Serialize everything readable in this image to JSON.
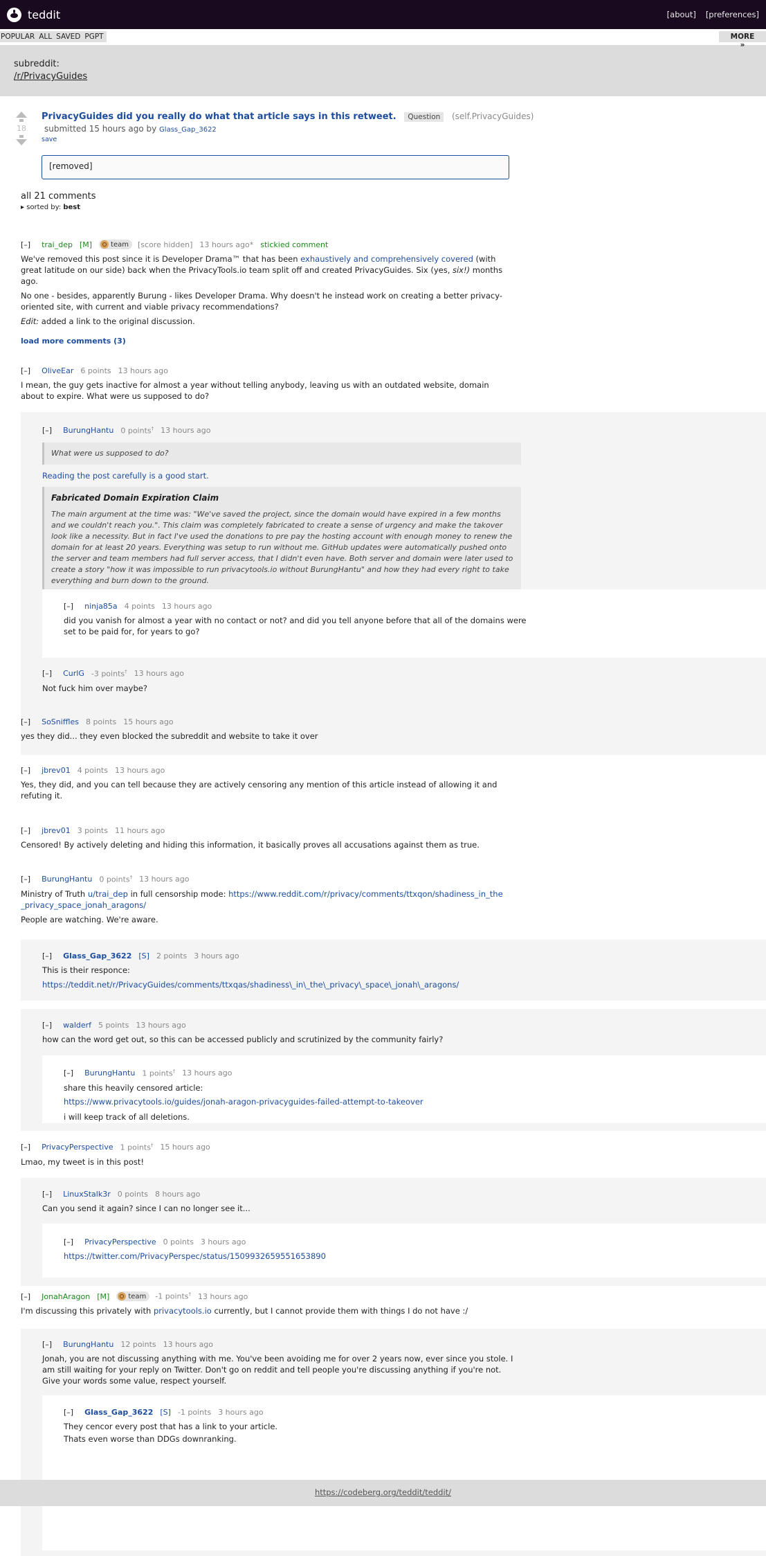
{
  "app": {
    "title": "teddit"
  },
  "topnav": {
    "about": "[about]",
    "preferences": "[preferences]"
  },
  "subnav": {
    "items": [
      "POPULAR",
      "ALL",
      "SAVED",
      "PGPT"
    ],
    "more": "MORE »"
  },
  "subreddit": {
    "label": "subreddit:",
    "name": "/r/PrivacyGuides"
  },
  "post": {
    "score": "18",
    "title": "PrivacyGuides did you really do what that article says in this retweet.",
    "flair": "Question",
    "domain": "(self.PrivacyGuides)",
    "submitted": "submitted 15 hours ago by",
    "author": "Glass_Gap_3622",
    "save": "save",
    "selftext": "[removed]"
  },
  "comments_header": {
    "count": "all 21 comments",
    "sorted_prefix": "▸ sorted by:",
    "sorted_value": "best"
  },
  "load_more": "load more comments (3)",
  "toggle": "[–]",
  "comments": {
    "c1": {
      "author": "trai_dep",
      "mod": "[M]",
      "badge": "team",
      "score": "[score hidden]",
      "time": "13 hours ago*",
      "stickied": "stickied comment",
      "p1a": "We've removed this post since it is Developer Drama™ that has been ",
      "p1link": "exhaustively and comprehensively covered",
      "p1b": " (with great latitude on our side) back when the PrivacyTools.io team split off and created PrivacyGuides. Six (yes, ",
      "p1em": "six!)",
      "p1c": " months ago.",
      "p2": "No one - besides, apparently Burung - likes Developer Drama. Why doesn't he instead work on creating a better privacy-oriented site, with current and viable privacy recommendations?",
      "p3em": "Edit:",
      "p3": " added a link to the original discussion."
    },
    "c2": {
      "author": "OliveEar",
      "points": "6 points",
      "time": "13 hours ago",
      "text": "I mean, the guy gets inactive for almost a year without telling anybody, leaving us with an outdated website, domain about to expire. What were us supposed to do?"
    },
    "c3": {
      "author": "BurungHantu",
      "points": "0 points",
      "dagger": "†",
      "time": "13 hours ago",
      "quote1": "What were us supposed to do?",
      "link": "Reading the post carefully is a good start.",
      "quote_title": "Fabricated Domain Expiration Claim",
      "quote2": "The main argument at the time was: \"We've saved the project, since the domain would have expired in a few months and we couldn't reach you.\". This claim was completely fabricated to create a sense of urgency and make the takover look like a necessity. But in fact I've used the donations to pre pay the hosting account with enough money to renew the domain for at least 20 years. Everything was setup to run without me. GitHub updates were automatically pushed onto the server and team members had full server access, that I didn't even have. Both server and domain were later used to create a story \"how it was impossible to run privacytools.io without BurungHantu\" and how they had every right to take everything and burn down to the ground."
    },
    "c4": {
      "author": "ninja85a",
      "points": "4 points",
      "time": "13 hours ago",
      "text": "did you vanish for almost a year with no contact or not? and did you tell anyone before that all of the domains were set to be paid for, for years to go?"
    },
    "c5": {
      "author": "CurlG",
      "points": "-3 points",
      "dagger": "†",
      "time": "13 hours ago",
      "text": "Not fuck him over maybe?"
    },
    "c6": {
      "author": "SoSniffles",
      "points": "8 points",
      "time": "15 hours ago",
      "text": "yes they did... they even blocked the subreddit and website to take it over"
    },
    "c7": {
      "author": "jbrev01",
      "points": "4 points",
      "time": "13 hours ago",
      "text": "Yes, they did, and you can tell because they are actively censoring any mention of this article instead of allowing it and refuting it."
    },
    "c8": {
      "author": "jbrev01",
      "points": "3 points",
      "time": "11 hours ago",
      "text": "Censored! By actively deleting and hiding this information, it basically proves all accusations against them as true."
    },
    "c9": {
      "author": "BurungHantu",
      "points": "0 points",
      "dagger": "†",
      "time": "13 hours ago",
      "t1": "Ministry of Truth ",
      "l1": "u/trai_dep",
      "t2": " in full censorship mode: ",
      "l2": "https://www.reddit.com/r/privacy/comments/ttxqon/shadiness_in_the_privacy_space_jonah_aragons/",
      "t3": "People are watching. We're aware."
    },
    "c10": {
      "author": "Glass_Gap_3622",
      "sub": "[S]",
      "points": "2 points",
      "time": "3 hours ago",
      "text": "This is their responce:",
      "link": "https://teddit.net/r/PrivacyGuides/comments/ttxqas/shadiness\\_in\\_the\\_privacy\\_space\\_jonah\\_aragons/"
    },
    "c11": {
      "author": "walderf",
      "points": "5 points",
      "time": "13 hours ago",
      "text": "how can the word get out, so this can be accessed publicly and scrutinized by the community fairly?"
    },
    "c12": {
      "author": "BurungHantu",
      "points": "1 points",
      "dagger": "†",
      "time": "13 hours ago",
      "t1": "share this heavily censored article:",
      "l1": "https://www.privacytools.io/guides/jonah-aragon-privacyguides-failed-attempt-to-takeover",
      "t2": "i will keep track of all deletions."
    },
    "c13": {
      "author": "PrivacyPerspective",
      "points": "1 points",
      "dagger": "†",
      "time": "15 hours ago",
      "text": "Lmao, my tweet is in this post!"
    },
    "c14": {
      "author": "LinuxStalk3r",
      "points": "0 points",
      "time": "8 hours ago",
      "text": "Can you send it again? since I can no longer see it..."
    },
    "c15": {
      "author": "PrivacyPerspective",
      "points": "0 points",
      "time": "3 hours ago",
      "link": "https://twitter.com/PrivacyPerspec/status/1509932659551653890"
    },
    "c16": {
      "author": "JonahAragon",
      "mod": "[M]",
      "badge": "team",
      "points": "-1 points",
      "dagger": "†",
      "time": "13 hours ago",
      "t1": "I'm discussing this privately with ",
      "l1": "privacytools.io",
      "t2": " currently, but I cannot provide them with things I do not have :/"
    },
    "c17": {
      "author": "BurungHantu",
      "points": "12 points",
      "time": "13 hours ago",
      "text": "Jonah, you are not discussing anything with me. You've been avoiding me for over 2 years now, ever since you stole. I am still waiting for your reply on Twitter. Don't go on reddit and tell people you're discussing anything if you're not. Give your words some value, respect yourself."
    },
    "c18": {
      "author": "Glass_Gap_3622",
      "sub": "[S]",
      "points": "-1 points",
      "time": "3 hours ago",
      "t1": "They cencor every post that has a link to your article.",
      "t2": "Thats even worse than DDGs downranking."
    }
  },
  "footer": {
    "link": "https://codeberg.org/teddit/teddit/"
  }
}
